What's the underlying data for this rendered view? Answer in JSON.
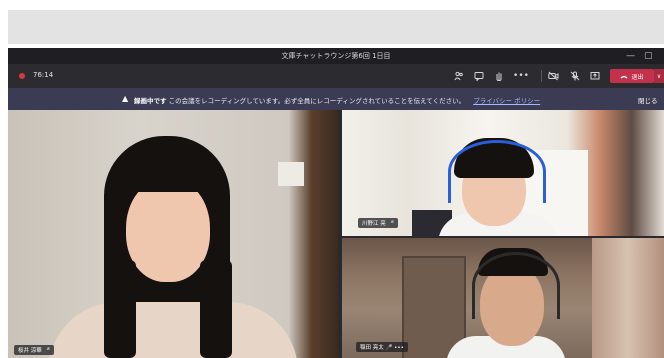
{
  "window": {
    "title": "文庫チャットラウンジ第6回 1日目",
    "minimize_glyph": "—",
    "maximize_glyph": "▢"
  },
  "toolbar": {
    "timer": "76:14",
    "icons": [
      "people-icon",
      "chat-icon",
      "raise-hand-icon",
      "more-icon",
      "camera-off-icon",
      "mic-off-icon",
      "share-icon"
    ],
    "leave_label": "退出",
    "leave_caret": "∨"
  },
  "banner": {
    "bold_text": "録画中です",
    "message": "この会議をレコーディングしています。必ず全員にレコーディングされていることを伝えてください。",
    "link": "プライバシー ポリシー",
    "close": "閉じる"
  },
  "participants": [
    {
      "name": "桜井 涼華",
      "mic": "🎤"
    },
    {
      "name": "川野江 亮",
      "mic": "🎤"
    },
    {
      "name": "稲田 亮太",
      "mic": "🎤",
      "more": "•••"
    }
  ],
  "colors": {
    "leave": "#c4314b",
    "banner": "#3b3b53",
    "titlebar": "#1f1f23",
    "headset": "#2b5fd9"
  }
}
